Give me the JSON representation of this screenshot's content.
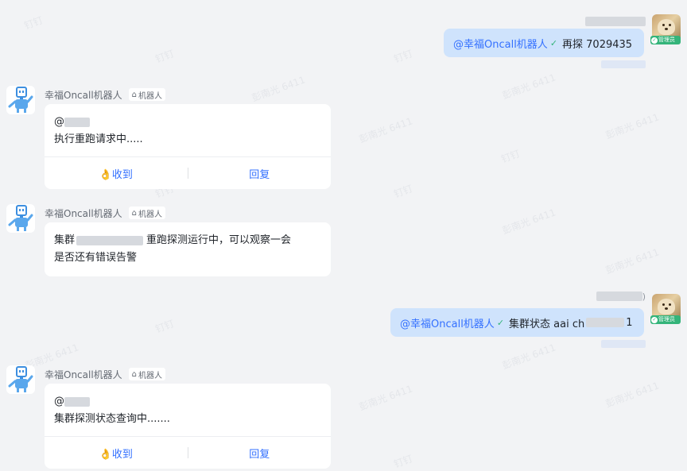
{
  "watermarks": {
    "a": "钉钉",
    "b": "彭南光 6411"
  },
  "bot": {
    "name": "幸福Oncall机器人",
    "tag_label": "机器人"
  },
  "messages": {
    "user1": {
      "mention": "@幸福Oncall机器人",
      "text": "再探 7029435"
    },
    "bot1": {
      "mention_prefix": "@",
      "line": "执行重跑请求中.....",
      "ack_label": "收到",
      "reply_label": "回复"
    },
    "bot2": {
      "prefix": "集群",
      "suffix": "重跑探测运行中，可以观察一会",
      "line2": "是否还有错误告警"
    },
    "user2": {
      "mention": "@幸福Oncall机器人",
      "text_prefix": "集群状态 aai ch",
      "text_suffix": "1",
      "name_suffix": ")"
    },
    "bot3": {
      "mention_prefix": "@",
      "line": "集群探测状态查询中.......",
      "ack_label": "收到",
      "reply_label": "回复"
    }
  },
  "badges": {
    "admin": "管理员"
  },
  "colors": {
    "mention": "#3370ff",
    "bubble": "#cfe3fc",
    "verified": "#34b47a"
  },
  "icons": {
    "bot_avatar": "robot-icon",
    "verified": "verified-check-icon",
    "ack": "ok-hand-icon",
    "bot_tag": "robot-tag-icon"
  }
}
